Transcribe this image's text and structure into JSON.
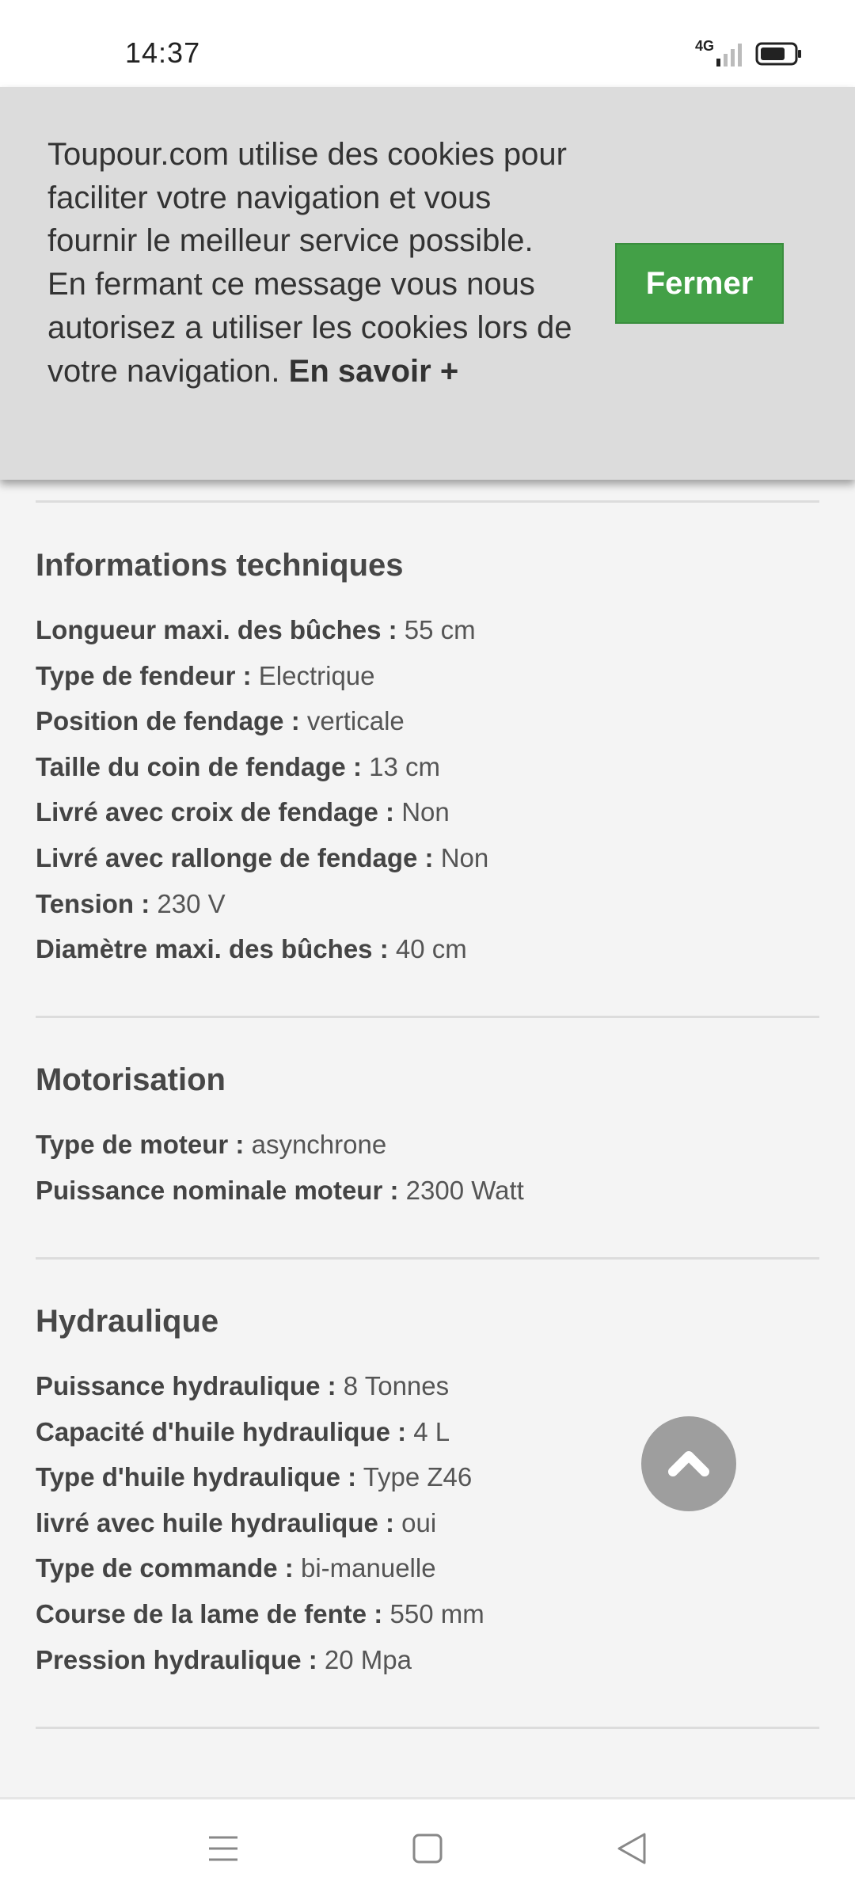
{
  "status_bar": {
    "time": "14:37",
    "network": "4G"
  },
  "cookie_banner": {
    "text_lines": [
      "Toupour.com utilise des cookies pour faciliter votre navigation et vous fournir le meilleur service possible.",
      "En fermant ce message vous nous autorisez a utiliser les cookies lors de votre navigation."
    ],
    "link_label": "En savoir +",
    "close_label": "Fermer"
  },
  "sections": [
    {
      "title": "Informations techniques",
      "rows": [
        {
          "key": "Longueur maxi. des bûches :",
          "value": "55 cm"
        },
        {
          "key": "Type de fendeur :",
          "value": "Electrique"
        },
        {
          "key": "Position de fendage :",
          "value": "verticale"
        },
        {
          "key": "Taille du coin de fendage :",
          "value": "13 cm"
        },
        {
          "key": "Livré avec croix de fendage :",
          "value": "Non"
        },
        {
          "key": "Livré avec rallonge de fendage :",
          "value": "Non"
        },
        {
          "key": "Tension :",
          "value": "230 V"
        },
        {
          "key": "Diamètre maxi. des bûches :",
          "value": "40 cm"
        }
      ]
    },
    {
      "title": "Motorisation",
      "rows": [
        {
          "key": "Type de moteur :",
          "value": "asynchrone"
        },
        {
          "key": "Puissance nominale moteur :",
          "value": "2300 Watt"
        }
      ]
    },
    {
      "title": "Hydraulique",
      "rows": [
        {
          "key": "Puissance hydraulique :",
          "value": "8 Tonnes"
        },
        {
          "key": "Capacité d'huile hydraulique :",
          "value": "4 L"
        },
        {
          "key": "Type d'huile hydraulique :",
          "value": "Type Z46"
        },
        {
          "key": "livré avec huile hydraulique :",
          "value": "oui"
        },
        {
          "key": "Type de commande :",
          "value": "bi-manuelle"
        },
        {
          "key": "Course de la lame de fente :",
          "value": "550 mm"
        },
        {
          "key": "Pression hydraulique :",
          "value": "20 Mpa"
        }
      ]
    }
  ],
  "icons": {
    "scroll_top": "chevron-up-icon",
    "nav_menu": "menu-icon",
    "nav_home": "home-square-icon",
    "nav_back": "back-triangle-icon",
    "battery": "battery-icon",
    "signal": "signal-icon"
  },
  "colors": {
    "accent_green": "#43a047",
    "banner_bg": "#dcdcdc",
    "page_bg": "#f4f4f4"
  }
}
